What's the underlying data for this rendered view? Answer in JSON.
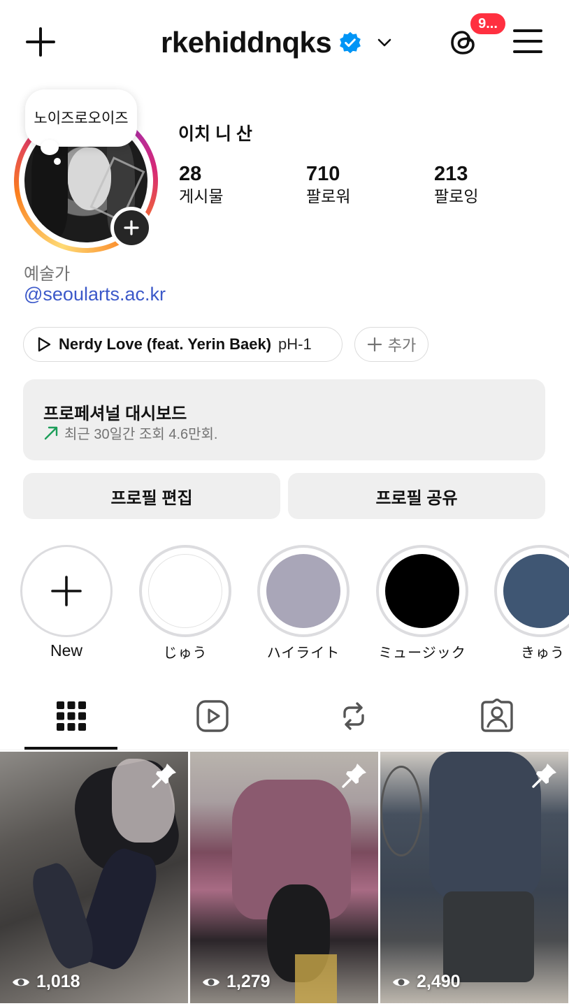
{
  "header": {
    "username": "rkehiddnqks",
    "notification_badge": "9..."
  },
  "profile": {
    "note": "노이즈로오이즈",
    "display_name": "이치 니 산",
    "stats": [
      {
        "value": "28",
        "label": "게시물"
      },
      {
        "value": "710",
        "label": "팔로워"
      },
      {
        "value": "213",
        "label": "팔로잉"
      }
    ],
    "category": "예술가",
    "link": "@seoularts.ac.kr"
  },
  "music": {
    "title": "Nerdy Love (feat. Yerin Baek)",
    "artist": "pH-1",
    "add_label": "추가"
  },
  "dashboard": {
    "title": "프로페셔널 대시보드",
    "subtitle": "최근 30일간 조회 4.6만회."
  },
  "buttons": {
    "edit_profile": "프로필 편집",
    "share_profile": "프로필 공유"
  },
  "highlights": [
    {
      "label": "New",
      "color": "#ffffff"
    },
    {
      "label": "じゅう",
      "color": "#ffffff"
    },
    {
      "label": "ハイライト",
      "color": "#a9a6b8"
    },
    {
      "label": "ミュージック",
      "color": "#000000"
    },
    {
      "label": "きゅう",
      "color": "#3f5673"
    }
  ],
  "tabs": [
    "grid-icon",
    "reels-icon",
    "reposts-icon",
    "tagged-icon"
  ],
  "posts": [
    {
      "views": "1,018",
      "pinned": true
    },
    {
      "views": "1,279",
      "pinned": true
    },
    {
      "views": "2,490",
      "pinned": true
    }
  ],
  "colors": {
    "link": "#3c59c9",
    "badge": "#ff3040",
    "verified": "#0095f6"
  }
}
